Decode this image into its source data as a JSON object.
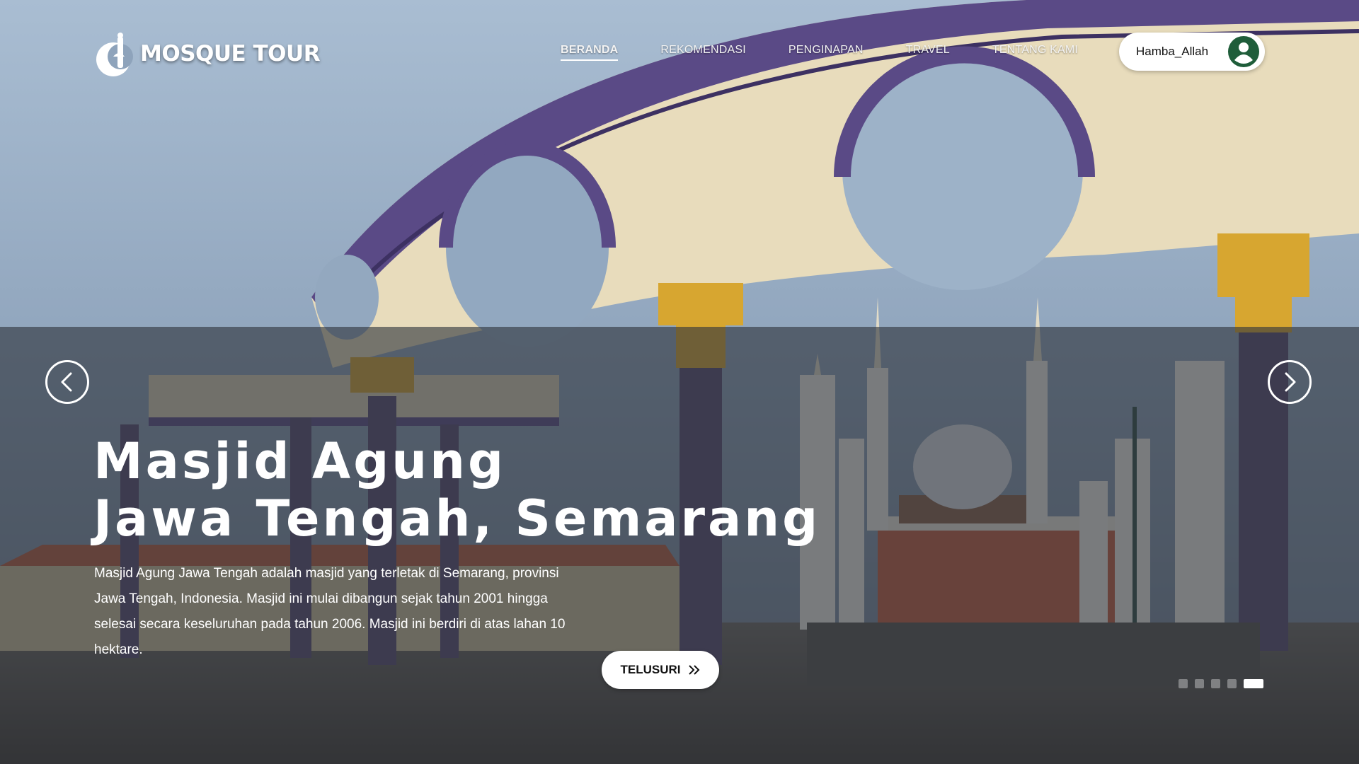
{
  "header": {
    "brand": "MOSQUE TOUR",
    "nav": [
      {
        "label": "BERANDA",
        "active": true
      },
      {
        "label": "REKOMENDASI",
        "active": false
      },
      {
        "label": "PENGINAPAN",
        "active": false
      },
      {
        "label": "TRAVEL",
        "active": false
      },
      {
        "label": "TENTANG KAMI",
        "active": false
      }
    ],
    "user": {
      "name": "Hamba_Allah",
      "icon": "user-circle-icon"
    }
  },
  "hero": {
    "title_line1": "Masjid Agung",
    "title_line2": "Jawa Tengah, Semarang",
    "description": "Masjid Agung Jawa Tengah adalah masjid yang terletak di Semarang, provinsi Jawa Tengah, Indonesia. Masjid ini mulai dibangun sejak tahun 2001 hingga selesai secara keseluruhan pada tahun 2006. Masjid ini berdiri di atas lahan 10 hektare.",
    "cta_label": "TELUSURI",
    "prev_icon": "chevron-left-icon",
    "next_icon": "chevron-right-icon"
  },
  "carousel": {
    "slide_count": 5,
    "active_index": 4
  },
  "colors": {
    "avatar": "#1f5d3a",
    "overlay": "#2e343c",
    "arch_purple": "#5a4a86",
    "arch_cream": "#eae2c6",
    "gold": "#d9a42a"
  }
}
